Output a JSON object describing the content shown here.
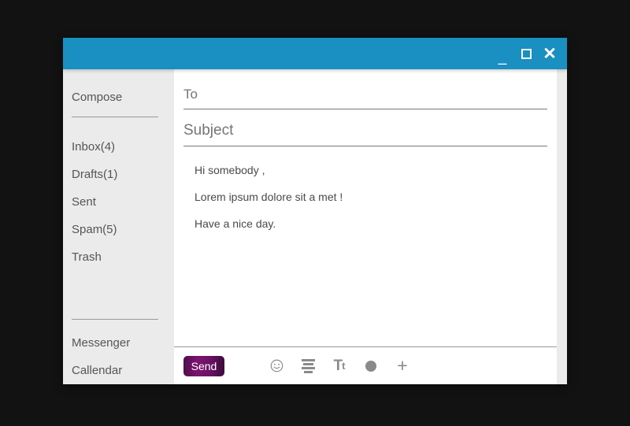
{
  "window": {
    "titlebar": {
      "color": "#1a8fc1",
      "controls": [
        {
          "name": "minimize",
          "glyph": "_"
        },
        {
          "name": "maximize",
          "glyph": ""
        },
        {
          "name": "close",
          "glyph": "✕"
        }
      ]
    }
  },
  "sidebar": {
    "background": "#ebebeb",
    "compose": "Compose",
    "folders": [
      {
        "label": "Inbox(4)"
      },
      {
        "label": "Drafts(1)"
      },
      {
        "label": "Sent"
      },
      {
        "label": "Spam(5)"
      },
      {
        "label": "Trash"
      }
    ],
    "apps": [
      {
        "label": "Messenger"
      },
      {
        "label": "Callendar"
      }
    ]
  },
  "compose": {
    "to": {
      "label": "To",
      "value": ""
    },
    "subject": {
      "label": "Subject",
      "value": ""
    },
    "body_lines": [
      "Hi somebody ,",
      "Lorem ipsum dolore sit a met !",
      "Have a nice day."
    ]
  },
  "toolbar": {
    "send_label": "Send",
    "send_color": "#6d1266",
    "icons": [
      {
        "name": "emoji-icon",
        "glyph": "☺"
      },
      {
        "name": "align-left-icon",
        "glyph": ""
      },
      {
        "name": "text-size-icon",
        "big": "T",
        "small": "t"
      },
      {
        "name": "attachment-circle-icon",
        "glyph": ""
      },
      {
        "name": "add-icon",
        "glyph": "+"
      }
    ]
  }
}
